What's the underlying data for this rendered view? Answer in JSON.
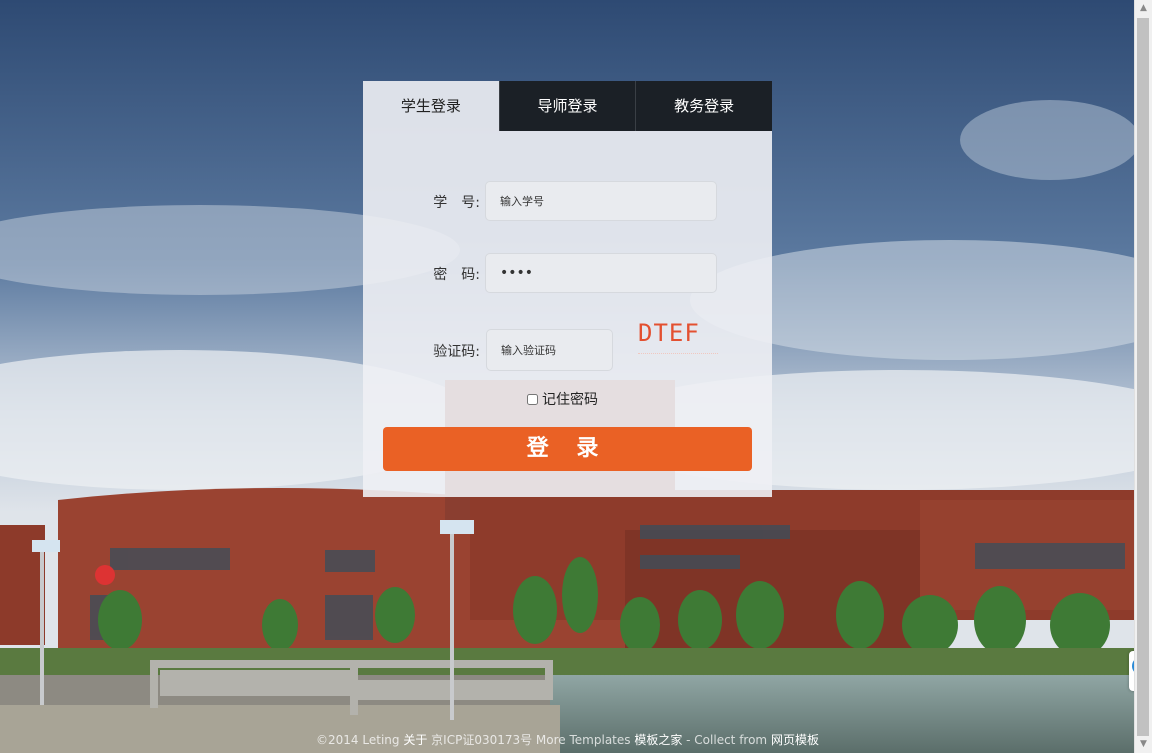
{
  "tabs": [
    "学生登录",
    "导师登录",
    "教务登录"
  ],
  "form": {
    "id_label": "学　号:",
    "id_placeholder": "输入学号",
    "pwd_label": "密　码:",
    "pwd_value": "1234",
    "code_label": "验证码:",
    "code_placeholder": "输入验证码",
    "captcha_text": "DTEF",
    "remember_label": "记住密码",
    "login_button": "登 录"
  },
  "footer": {
    "copyright": "©2014  Leting  ",
    "about": "关于",
    "icp": "  京ICP证030173号  More  Templates  ",
    "link1": "模板之家",
    "mid": "  -  Collect  from  ",
    "link2": "网页模板"
  },
  "colors": {
    "accent": "#ea6125",
    "tab_dark": "#1b2026",
    "captcha": "#e35030"
  }
}
